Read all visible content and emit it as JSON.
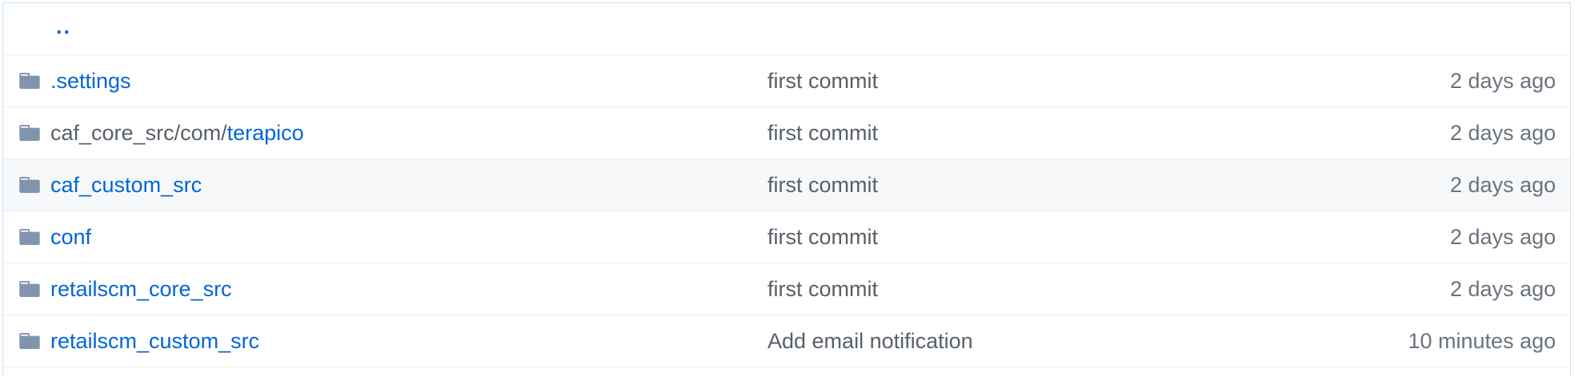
{
  "table": {
    "up_label": "..",
    "rows": [
      {
        "prefix": "",
        "name": ".settings",
        "message": "first commit",
        "age": "2 days ago"
      },
      {
        "prefix": "caf_core_src/com/",
        "name": "terapico",
        "message": "first commit",
        "age": "2 days ago"
      },
      {
        "prefix": "",
        "name": "caf_custom_src",
        "message": "first commit",
        "age": "2 days ago"
      },
      {
        "prefix": "",
        "name": "conf",
        "message": "first commit",
        "age": "2 days ago"
      },
      {
        "prefix": "",
        "name": "retailscm_core_src",
        "message": "first commit",
        "age": "2 days ago"
      },
      {
        "prefix": "",
        "name": "retailscm_custom_src",
        "message": "Add email notification",
        "age": "10 minutes ago"
      }
    ]
  },
  "icons": {
    "folder": "folder-icon"
  },
  "colors": {
    "link": "#0366d6",
    "folder": "#79b8ff",
    "muted_text": "#586069",
    "age_text": "#6a737d",
    "row_border": "#eaecef",
    "table_border": "#c8e1ff",
    "hover_bg": "#f6f8fa"
  }
}
